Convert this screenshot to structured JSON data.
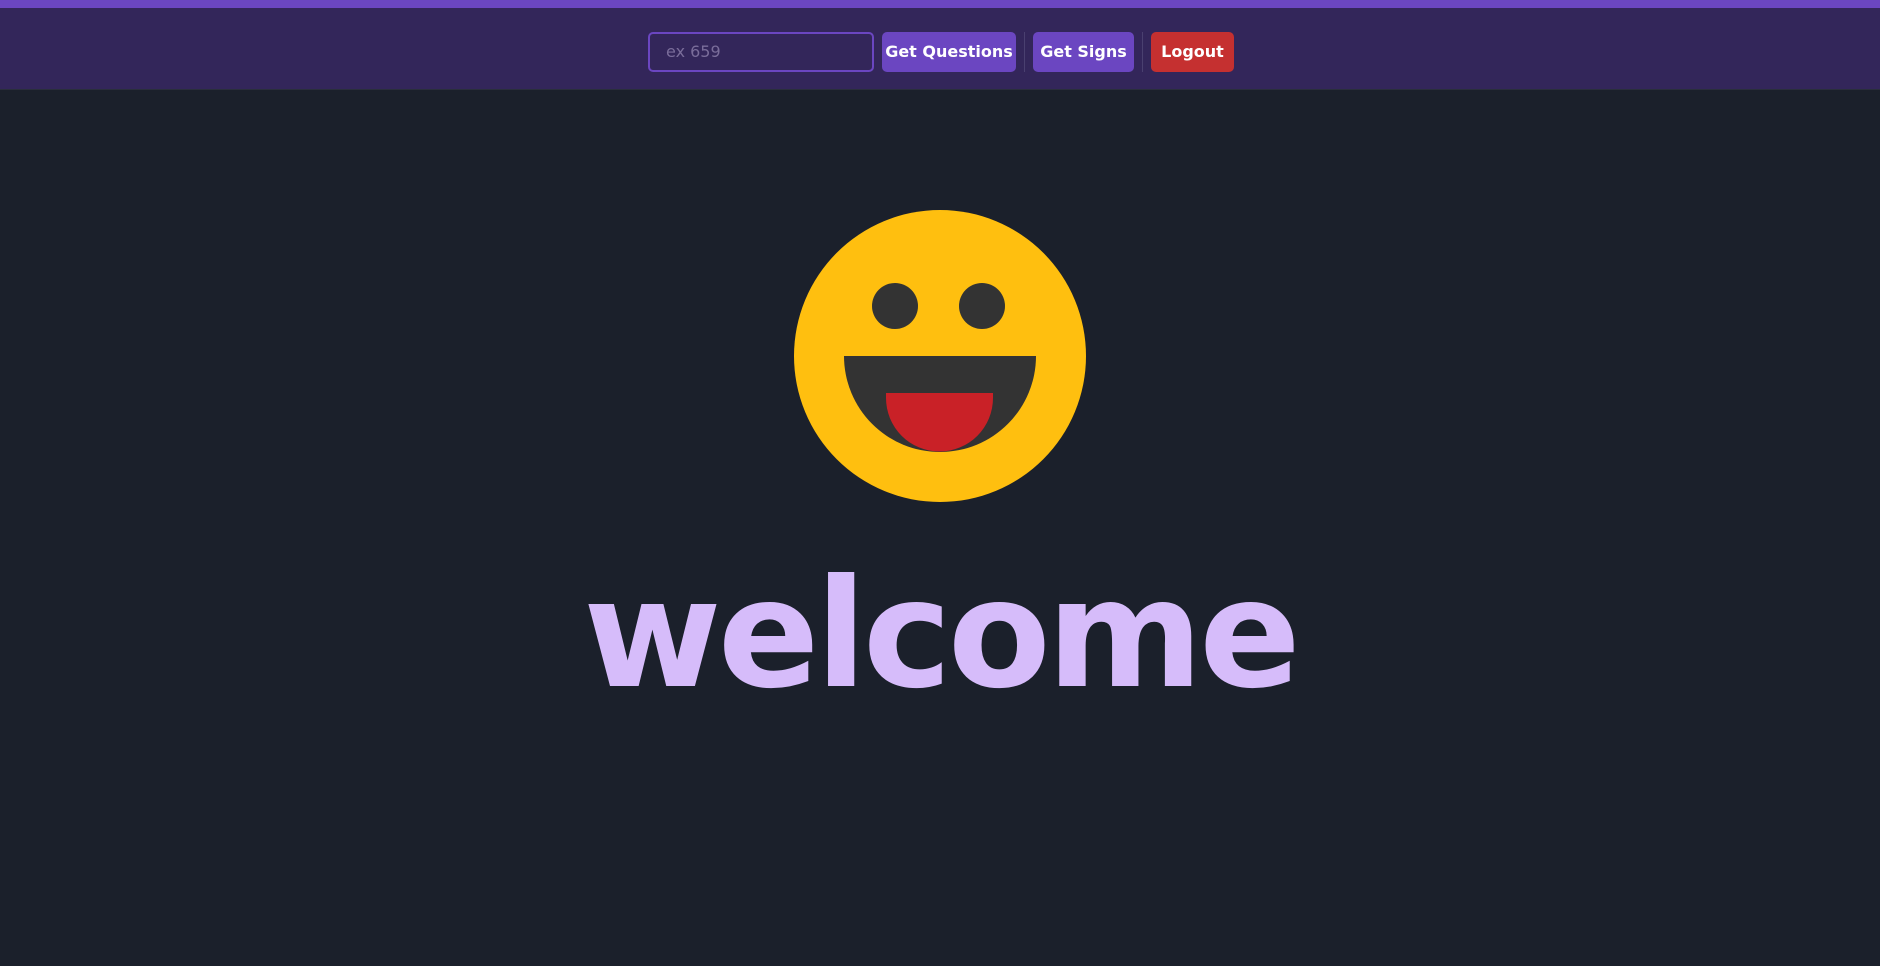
{
  "topbar": {
    "code_input": {
      "placeholder": "ex 659",
      "value": ""
    },
    "get_questions_label": "Get Questions",
    "get_signs_label": "Get Signs",
    "logout_label": "Logout"
  },
  "hero": {
    "icon": "grinning-face-icon",
    "title": "welcome"
  },
  "colors": {
    "background": "#1b202b",
    "topbar": "#33265a",
    "accent": "#6b46c1",
    "danger": "#c53030",
    "welcome_text": "#d6bcfa",
    "smiley_face": "#ffbf0f",
    "smiley_features": "#333333",
    "smiley_tongue": "#c92127"
  }
}
